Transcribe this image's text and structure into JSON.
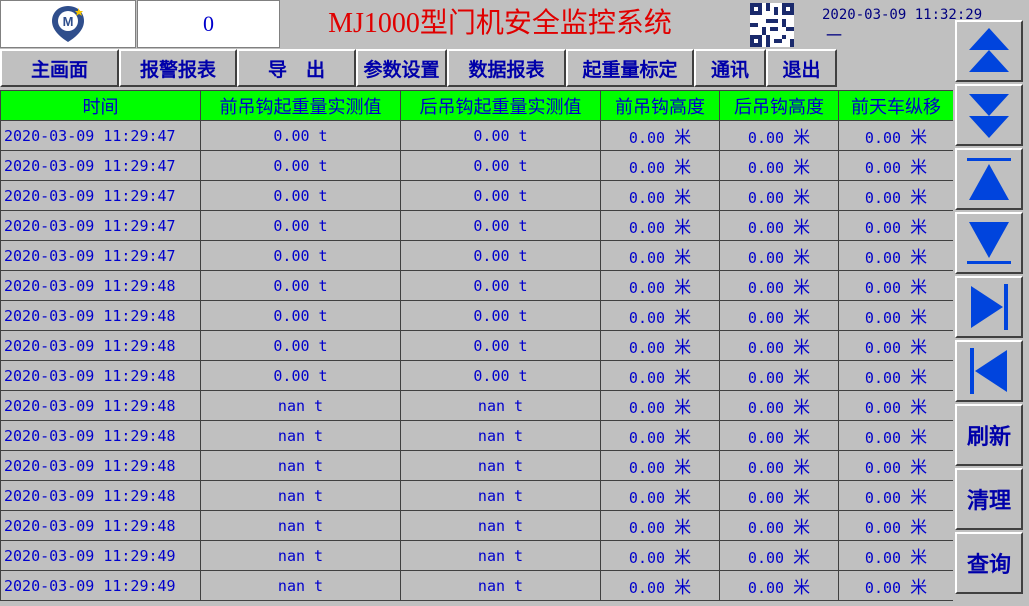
{
  "header": {
    "counter_value": "0",
    "app_title": "MJ1000型门机安全监控系统",
    "datetime": "2020-03-09 11:32:29",
    "weekday": "一"
  },
  "menu": [
    {
      "label": "主画面"
    },
    {
      "label": "报警报表"
    },
    {
      "label": "导    出"
    },
    {
      "label": "参数设置"
    },
    {
      "label": "数据报表"
    },
    {
      "label": "起重量标定"
    },
    {
      "label": "通讯"
    },
    {
      "label": "退出"
    }
  ],
  "table": {
    "columns": [
      "时间",
      "前吊钩起重量实测值",
      "后吊钩起重量实测值",
      "前吊钩高度",
      "后吊钩高度",
      "前天车纵移"
    ],
    "rows": [
      [
        "2020-03-09 11:29:47",
        "0.00 t",
        "0.00 t",
        "0.00",
        "0.00",
        "0.00"
      ],
      [
        "2020-03-09 11:29:47",
        "0.00 t",
        "0.00 t",
        "0.00",
        "0.00",
        "0.00"
      ],
      [
        "2020-03-09 11:29:47",
        "0.00 t",
        "0.00 t",
        "0.00",
        "0.00",
        "0.00"
      ],
      [
        "2020-03-09 11:29:47",
        "0.00 t",
        "0.00 t",
        "0.00",
        "0.00",
        "0.00"
      ],
      [
        "2020-03-09 11:29:47",
        "0.00 t",
        "0.00 t",
        "0.00",
        "0.00",
        "0.00"
      ],
      [
        "2020-03-09 11:29:48",
        "0.00 t",
        "0.00 t",
        "0.00",
        "0.00",
        "0.00"
      ],
      [
        "2020-03-09 11:29:48",
        "0.00 t",
        "0.00 t",
        "0.00",
        "0.00",
        "0.00"
      ],
      [
        "2020-03-09 11:29:48",
        "0.00 t",
        "0.00 t",
        "0.00",
        "0.00",
        "0.00"
      ],
      [
        "2020-03-09 11:29:48",
        "0.00 t",
        "0.00 t",
        "0.00",
        "0.00",
        "0.00"
      ],
      [
        "2020-03-09 11:29:48",
        "nan t",
        "nan t",
        "0.00",
        "0.00",
        "0.00"
      ],
      [
        "2020-03-09 11:29:48",
        "nan t",
        "nan t",
        "0.00",
        "0.00",
        "0.00"
      ],
      [
        "2020-03-09 11:29:48",
        "nan t",
        "nan t",
        "0.00",
        "0.00",
        "0.00"
      ],
      [
        "2020-03-09 11:29:48",
        "nan t",
        "nan t",
        "0.00",
        "0.00",
        "0.00"
      ],
      [
        "2020-03-09 11:29:48",
        "nan t",
        "nan t",
        "0.00",
        "0.00",
        "0.00"
      ],
      [
        "2020-03-09 11:29:49",
        "nan t",
        "nan t",
        "0.00",
        "0.00",
        "0.00"
      ],
      [
        "2020-03-09 11:29:49",
        "nan t",
        "nan t",
        "0.00",
        "0.00",
        "0.00"
      ]
    ],
    "height_unit": "米"
  },
  "right_panel": {
    "refresh_label": "刷新",
    "clear_label": "清理",
    "query_label": "查询"
  },
  "colors": {
    "header_green": "#00ff00",
    "text_blue": "#0000cc",
    "title_red": "#e00000",
    "panel_gray": "#c0c0c0"
  }
}
